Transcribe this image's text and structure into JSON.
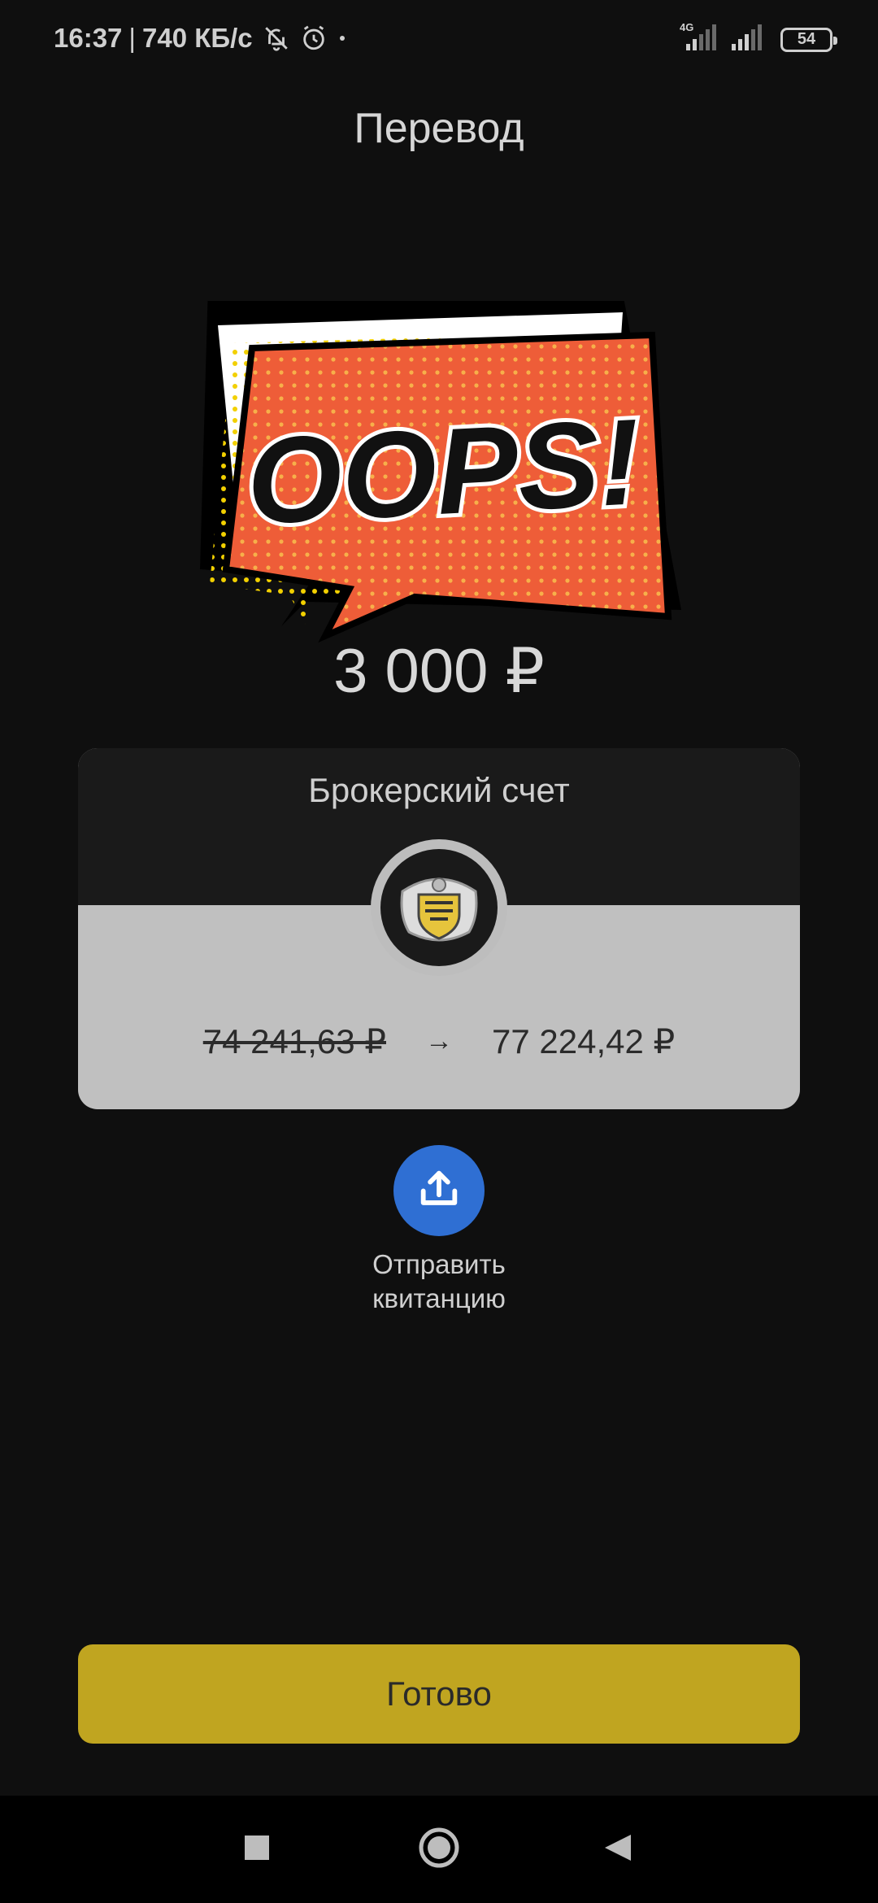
{
  "status_bar": {
    "time": "16:37",
    "separator": "|",
    "speed": "740 КБ/с",
    "network_type": "4G",
    "battery": "54"
  },
  "header": {
    "title": "Перевод"
  },
  "sticker": {
    "text": "OOPS!"
  },
  "transfer": {
    "amount": "3 000 ₽"
  },
  "account_card": {
    "title": "Брокерский счет",
    "old_balance": "74 241,63 ₽",
    "new_balance": "77 224,42 ₽",
    "arrow": "→"
  },
  "share": {
    "label_line1": "Отправить",
    "label_line2": "квитанцию",
    "icon": "share-icon"
  },
  "done_button": {
    "label": "Готово"
  },
  "colors": {
    "background": "#0f0f0f",
    "accent_yellow": "#c0a520",
    "share_blue": "#2f6fd3",
    "card_light": "#c0c0c0",
    "card_dark": "#1a1a1a",
    "sticker_orange": "#f0603a"
  }
}
